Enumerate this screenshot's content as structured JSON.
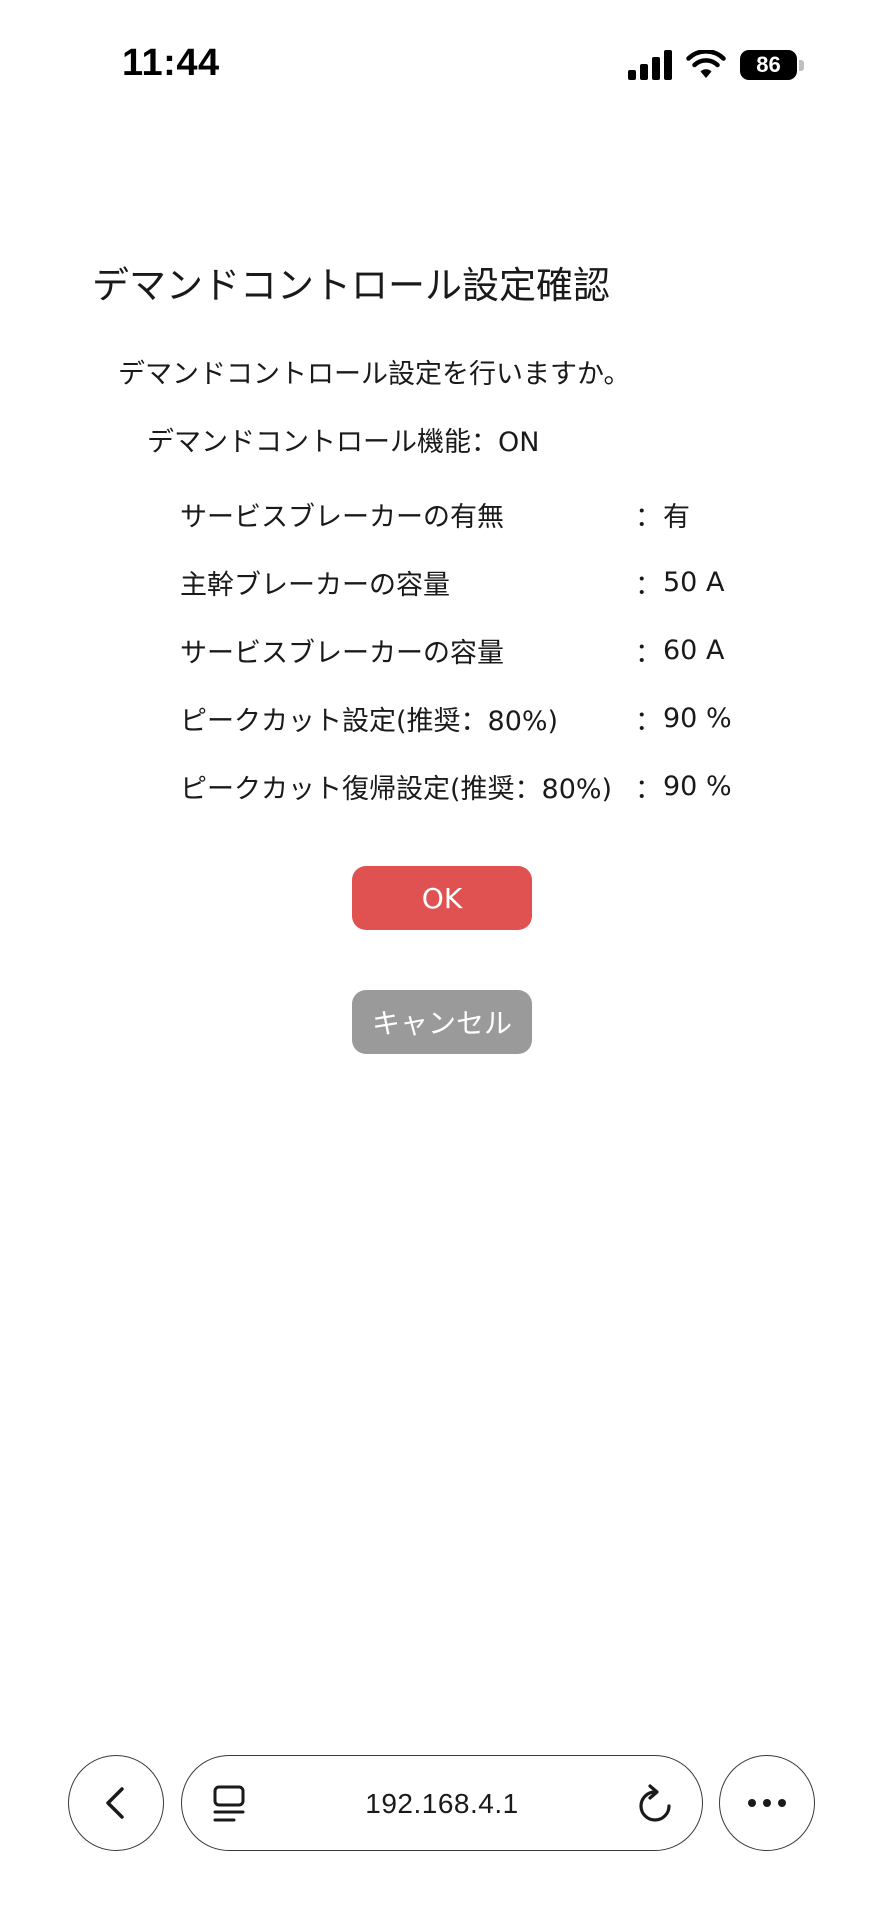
{
  "status_bar": {
    "time": "11:44",
    "battery": "86"
  },
  "dialog": {
    "title": "デマンドコントロール設定確認",
    "question": "デマンドコントロール設定を行いますか。",
    "function_line": "デマンドコントロール機能：ON",
    "settings": [
      {
        "label": "サービスブレーカーの有無",
        "sep": "：",
        "value": "有"
      },
      {
        "label": "主幹ブレーカーの容量",
        "sep": "：",
        "value": "50 A"
      },
      {
        "label": "サービスブレーカーの容量",
        "sep": "：",
        "value": "60 A"
      },
      {
        "label": "ピークカット設定(推奨：80%)",
        "sep": "：",
        "value": "90 %"
      },
      {
        "label": "ピークカット復帰設定(推奨：80%)",
        "sep": "：",
        "value": "90 %"
      }
    ],
    "ok_label": "OK",
    "cancel_label": "キャンセル"
  },
  "browser": {
    "url": "192.168.4.1"
  },
  "colors": {
    "ok_button": "#e05252",
    "cancel_button": "#9a9a9a"
  },
  "icons": {
    "back": "chevron-left-icon",
    "tabs": "tabs-icon",
    "reload": "reload-icon",
    "more": "more-horizontal-icon",
    "signal": "signal-icon",
    "wifi": "wifi-icon",
    "battery": "battery-icon"
  }
}
